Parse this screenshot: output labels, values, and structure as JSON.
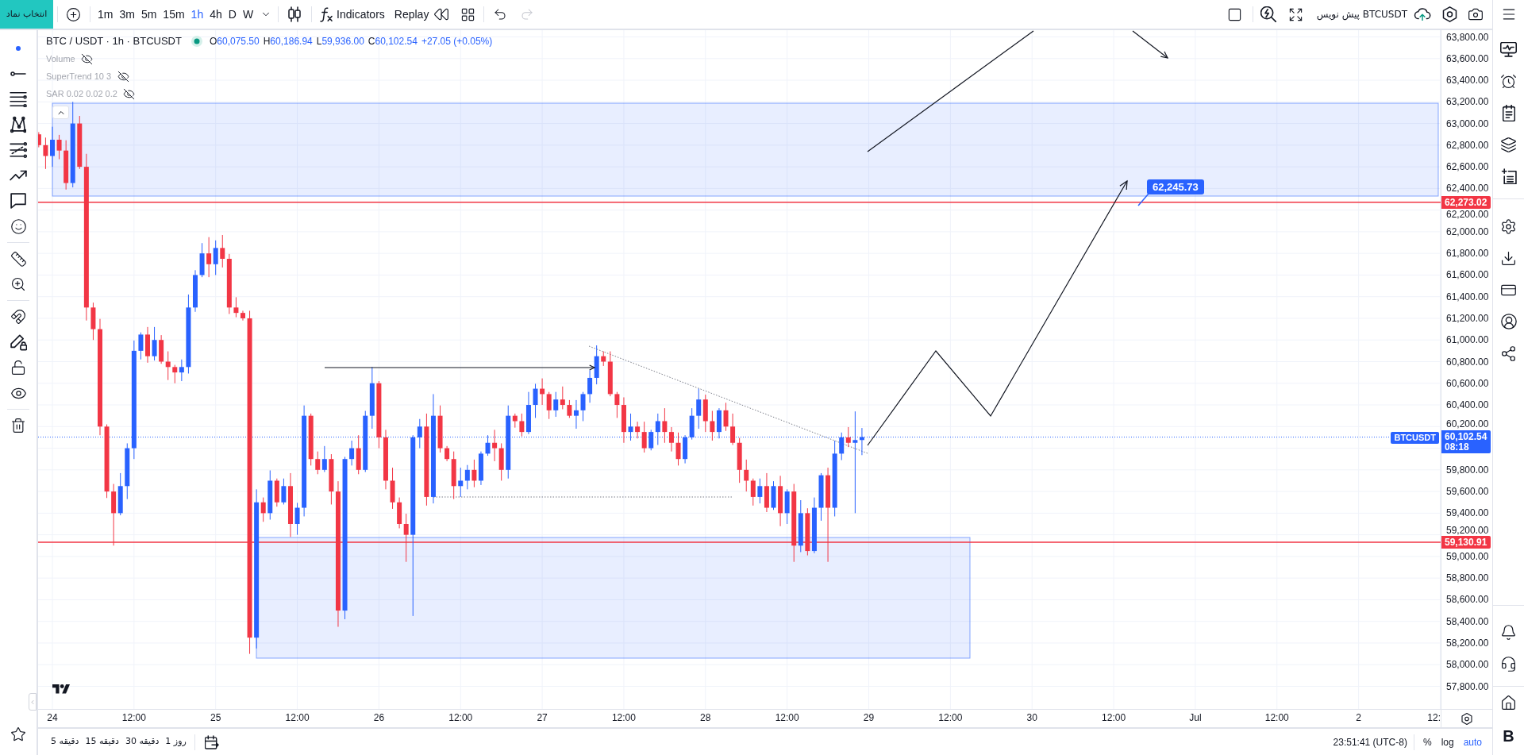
{
  "top_toolbar": {
    "symbol_button": "انتخاب نماد",
    "intervals": [
      {
        "label": "1m",
        "selected": false
      },
      {
        "label": "3m",
        "selected": false
      },
      {
        "label": "5m",
        "selected": false
      },
      {
        "label": "15m",
        "selected": false
      },
      {
        "label": "1h",
        "selected": true
      },
      {
        "label": "4h",
        "selected": false
      },
      {
        "label": "D",
        "selected": false
      },
      {
        "label": "W",
        "selected": false
      }
    ],
    "indicators_button": "Indicators",
    "replay_button": "Replay",
    "undo": {
      "disabled": false
    },
    "redo": {
      "disabled": true
    },
    "layout_name": "BTCUSDT پیش نویس"
  },
  "legend": {
    "title": "BTC / USDT · 1h · BTCUSDT",
    "ohlc": [
      {
        "label": "O",
        "value": "60,075.50"
      },
      {
        "label": "H",
        "value": "60,186.94"
      },
      {
        "label": "L",
        "value": "59,936.00"
      },
      {
        "label": "C",
        "value": "60,102.54"
      }
    ],
    "change": "+27.05 (+0.05%)",
    "indicators": [
      {
        "name": "Volume",
        "hidden": true
      },
      {
        "name": "SuperTrend 10 3",
        "hidden": true
      },
      {
        "name": "SAR 0.02 0.02 0.2",
        "hidden": true
      }
    ]
  },
  "chart": {
    "price_axis": [
      "63,800.00",
      "63,600.00",
      "63,400.00",
      "63,200.00",
      "63,000.00",
      "62,800.00",
      "62,600.00",
      "62,400.00",
      "62,200.00",
      "62,000.00",
      "61,800.00",
      "61,600.00",
      "61,400.00",
      "61,200.00",
      "61,000.00",
      "60,800.00",
      "60,600.00",
      "60,400.00",
      "60,200.00",
      "59,800.00",
      "59,600.00",
      "59,400.00",
      "59,200.00",
      "59,000.00",
      "58,800.00",
      "58,600.00",
      "58,400.00",
      "58,200.00",
      "58,000.00",
      "57,800.00"
    ],
    "time_axis": [
      "24",
      "12:00",
      "25",
      "12:00",
      "26",
      "12:00",
      "27",
      "12:00",
      "28",
      "12:00",
      "29",
      "12:00",
      "30",
      "12:00",
      "Jul",
      "12:00",
      "2",
      "12:"
    ],
    "line_tags": [
      {
        "price": "62,273.02"
      },
      {
        "price": "59,130.91"
      }
    ],
    "price_note": "62,245.73",
    "symbol_tag": "BTCUSDT",
    "last_price": "60,102.54",
    "countdown": "08:18"
  },
  "bottom_bar": {
    "ranges": [
      "1 روز",
      "30 دقیقه",
      "15 دقیقه",
      "5 دقیقه"
    ],
    "clock": "23:51:41 (UTC-8)",
    "scale_options": [
      {
        "label": "%",
        "selected": false
      },
      {
        "label": "log",
        "selected": false
      },
      {
        "label": "auto",
        "selected": true
      }
    ]
  },
  "right_sidebar": {
    "logo": "B"
  }
}
